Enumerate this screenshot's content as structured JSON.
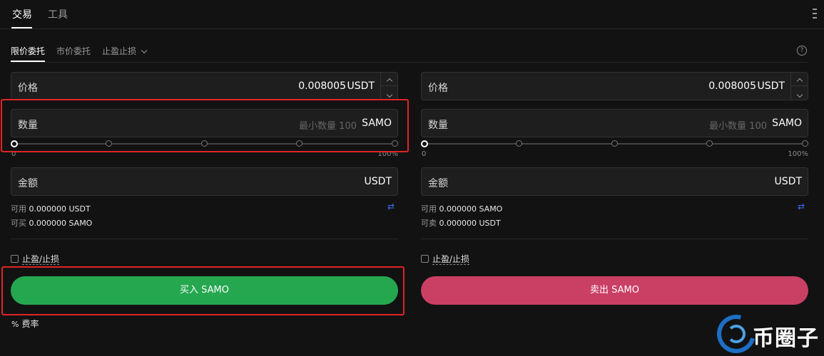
{
  "top_tabs": [
    "交易",
    "工具"
  ],
  "order_tabs": [
    "限价委托",
    "市价委托",
    "止盈止损"
  ],
  "help_icon_glyph": "?",
  "buy": {
    "price_label": "价格",
    "price_value": "0.008005",
    "price_unit": "USDT",
    "qty_label": "数量",
    "qty_placeholder": "最小数量 100",
    "qty_unit": "SAMO",
    "slider_min": "0",
    "slider_max": "100%",
    "slider_value": 0,
    "amount_label": "金额",
    "amount_unit": "USDT",
    "available_label": "可用",
    "available_value": "0.000000 USDT",
    "max_label": "可买",
    "max_value": "0.000000 SAMO",
    "tpsl_label": "止盈/止损",
    "button_label": "买入 SAMO"
  },
  "sell": {
    "price_label": "价格",
    "price_value": "0.008005",
    "price_unit": "USDT",
    "qty_label": "数量",
    "qty_placeholder": "最小数量 100",
    "qty_unit": "SAMO",
    "slider_min": "0",
    "slider_max": "100%",
    "slider_value": 0,
    "amount_label": "金额",
    "amount_unit": "USDT",
    "available_label": "可用",
    "available_value": "0.000000 SAMO",
    "max_label": "可卖",
    "max_value": "0.000000 USDT",
    "tpsl_label": "止盈/止损",
    "button_label": "卖出 SAMO"
  },
  "fee_rate": {
    "icon": "%",
    "label": "费率"
  },
  "watermark": "币圈子",
  "colors": {
    "background": "#121212",
    "buy_green": "#25a750",
    "sell_red": "#ca3f64",
    "highlight_red": "#e02424",
    "swap_blue": "#3b6ef5"
  }
}
